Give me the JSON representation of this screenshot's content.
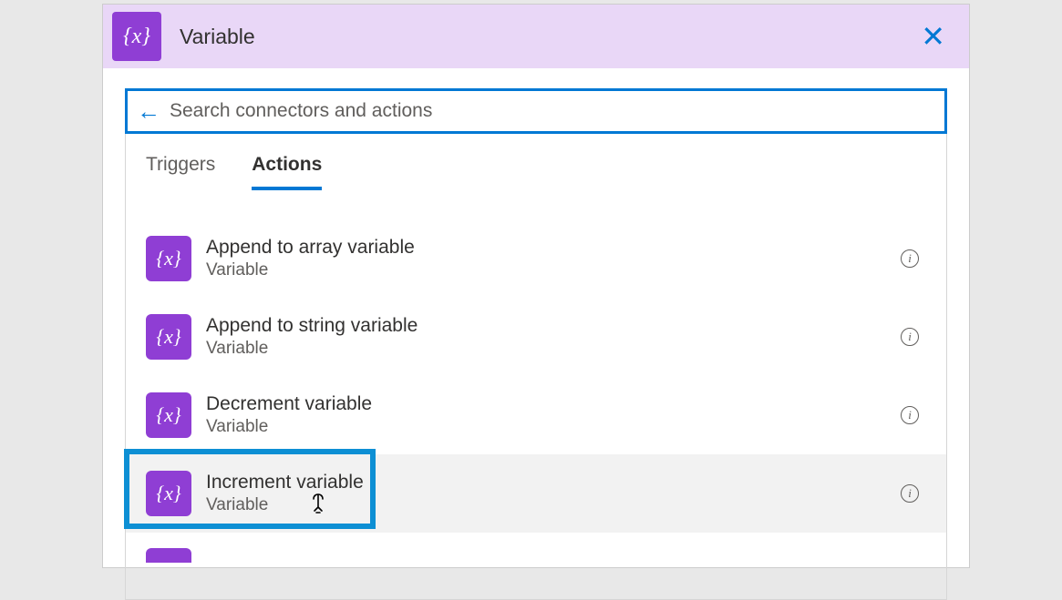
{
  "header": {
    "icon_glyph": "{x}",
    "title": "Variable"
  },
  "search": {
    "placeholder": "Search connectors and actions"
  },
  "tabs": {
    "triggers": "Triggers",
    "actions": "Actions"
  },
  "actions": [
    {
      "title": "Append to array variable",
      "subtitle": "Variable",
      "icon": "{x}"
    },
    {
      "title": "Append to string variable",
      "subtitle": "Variable",
      "icon": "{x}"
    },
    {
      "title": "Decrement variable",
      "subtitle": "Variable",
      "icon": "{x}"
    },
    {
      "title": "Increment variable",
      "subtitle": "Variable",
      "icon": "{x}"
    }
  ]
}
